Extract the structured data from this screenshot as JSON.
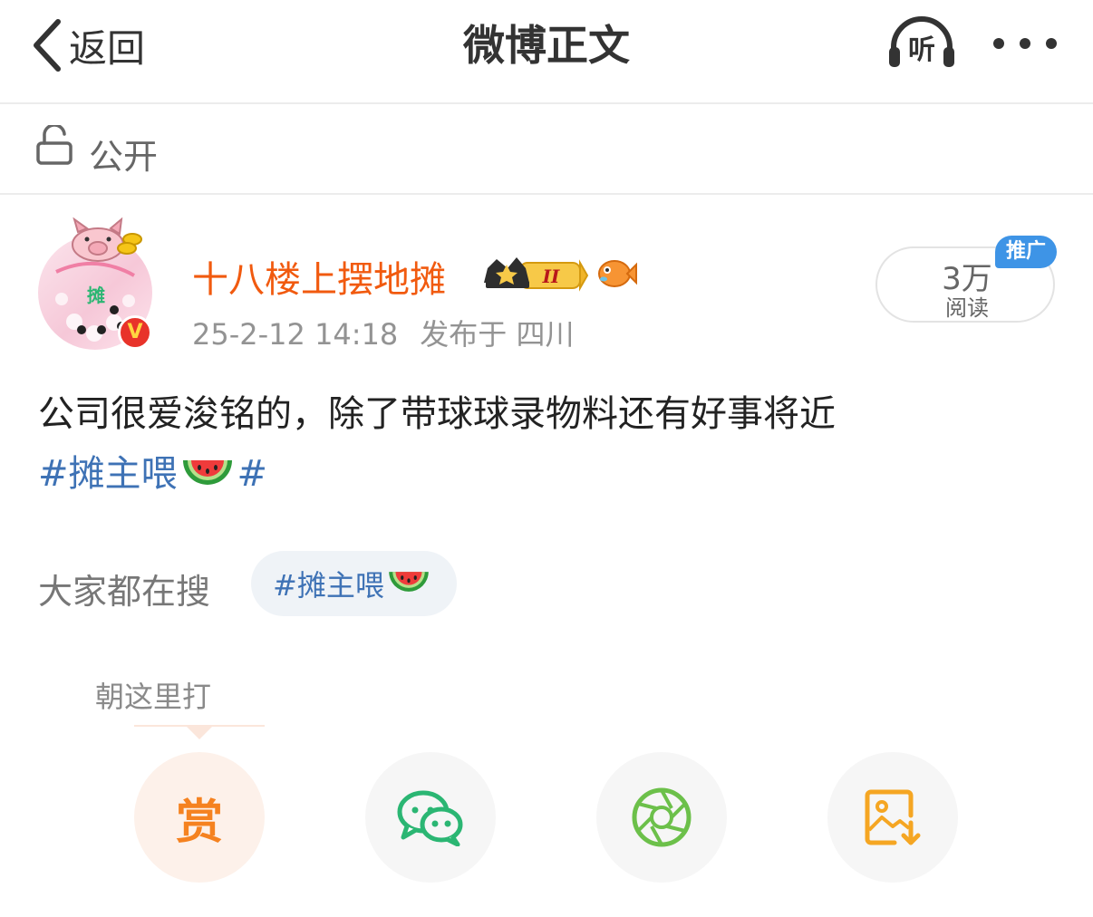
{
  "header": {
    "back_label": "返回",
    "title": "微博正文",
    "listen_label": "听"
  },
  "visibility": {
    "label": "公开"
  },
  "author": {
    "name": "十八楼上摆地摊",
    "avatar_text": "摊",
    "verified_mark": "V",
    "timestamp": "25-2-12 14:18",
    "location": "发布于 四川",
    "crown_level": "II",
    "name_color": "#f15a0f"
  },
  "reads": {
    "count": "3万",
    "label": "阅读",
    "promo_badge": "推广"
  },
  "post": {
    "text": "公司很爱浚铭的，除了带球球录物料还有好事将近",
    "tag_text": "#摊主喂",
    "tag_end": "#",
    "tag_color": "#3e72b5"
  },
  "hot_search": {
    "label": "大家都在搜",
    "item": "#摊主喂"
  },
  "actions": {
    "tip": "朝这里打",
    "reward_label": "赏",
    "items": [
      "reward",
      "wechat",
      "moments",
      "save-image"
    ],
    "colors": {
      "reward": "#f58220",
      "wechat": "#2bb673",
      "moments": "#6cc04a",
      "save": "#f5a623"
    }
  }
}
